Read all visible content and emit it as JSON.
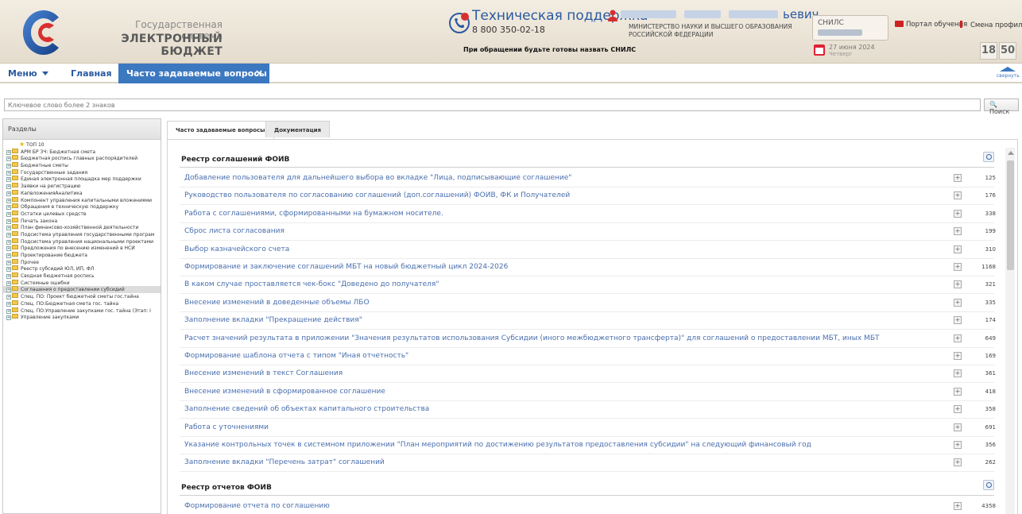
{
  "header": {
    "system_line1": "Государственная система",
    "system_line2": "ЭЛЕКТРОННЫЙ БЮДЖЕТ",
    "support_title": "Техническая поддержка",
    "support_phone": "8 800 350-02-18",
    "support_note": "При обращении будьте готовы назвать СНИЛС",
    "user_name_tail": "ьевич",
    "ministry": "МИНИСТЕРСТВО НАУКИ И ВЫСШЕГО ОБРАЗОВАНИЯ РОССИЙСКОЙ ФЕДЕРАЦИИ",
    "snils_label": "СНИЛС",
    "date": "27 июня 2024",
    "weekday": "Четверг",
    "portal_label": "Портал обучения",
    "change_profile_label": "Смена профиля",
    "clock_hours": "18",
    "clock_minutes": "50",
    "accent": "#3c78c0"
  },
  "nav": {
    "menu_label": "Меню",
    "home_label": "Главная",
    "active_tab_label": "Часто задаваемые вопросы",
    "close_symbol": "×",
    "collapse_label": "свернуть"
  },
  "search": {
    "placeholder": "Ключевое слово более 2 знаков",
    "button_label": "Поиск"
  },
  "left": {
    "header": "Разделы",
    "top_item": "ТОП 10",
    "items": [
      "АРМ БР 3Ч: Бюджетная смета",
      "Бюджетная роспись главных распорядителей",
      "Бюджетные сметы",
      "Государственные задания",
      "Единая электронная площадка мер поддержки",
      "Заявки на регистрацию",
      "КапвложенияАналитика",
      "Компонент управления капитальными вложениями",
      "Обращения в техническую поддержку",
      "Остатки целевых средств",
      "Печать закона",
      "План финансово-хозяйственной деятельности",
      "Подсистема управления государственными програм",
      "Подсистема управления национальными проектами",
      "Предложения по внесению изменений в НСИ",
      "Проектирование бюджета",
      "Прочее",
      "Реестр субсидий ЮЛ, ИП, ФЛ",
      "Сводная бюджетная роспись",
      "Системные ошибки",
      "Соглашения о предоставлении субсидий",
      "Спец. ПО: Проект бюджетной сметы гос.тайна",
      "Спец. ПО:Бюджетная смета гос. тайна",
      "Спец. ПО:Управление закупками гос. тайна (Этап: I",
      "Управление закупками"
    ],
    "selected_index": 20
  },
  "tabs": {
    "faq": "Часто задаваемые вопросы",
    "docs": "Документация"
  },
  "sections": [
    {
      "title": "Реестр соглашений ФОИВ",
      "rows": [
        {
          "text": "Добавление пользователя для дальнейшего выбора во вкладке \"Лица, подписывающие соглашение\"",
          "count": "125"
        },
        {
          "text": "Руководство пользователя по согласованию соглашений (доп.соглашений) ФОИВ, ФК и Получателей",
          "count": "176"
        },
        {
          "text": "Работа с соглашениями, сформированными на бумажном носителе.",
          "count": "338"
        },
        {
          "text": "Сброс листа согласования",
          "count": "199"
        },
        {
          "text": "Выбор казначейского счета",
          "count": "310"
        },
        {
          "text": "Формирование и заключение соглашений МБТ на новый бюджетный цикл 2024-2026",
          "count": "1168"
        },
        {
          "text": "В каком случае проставляется чек-бокс \"Доведено до получателя\"",
          "count": "321"
        },
        {
          "text": "Внесение изменений в доведенные объемы ЛБО",
          "count": "335"
        },
        {
          "text": "Заполнение вкладки \"Прекращение действия\"",
          "count": "174"
        },
        {
          "text": "Расчет значений результата в приложении \"Значения результатов использования Субсидии (иного межбюджетного трансферта)\" для соглашений о предоставлении МБТ, иных МБТ",
          "count": "649"
        },
        {
          "text": "Формирование шаблона отчета с типом \"Иная отчетность\"",
          "count": "169"
        },
        {
          "text": "Внесение изменений в текст Соглашения",
          "count": "361"
        },
        {
          "text": "Внесение изменений в сформированное соглашение",
          "count": "418"
        },
        {
          "text": "Заполнение сведений об объектах капитального строительства",
          "count": "358"
        },
        {
          "text": "Работа с уточнениями",
          "count": "691"
        },
        {
          "text": "Указание контрольных точек в системном приложении \"План мероприятий по достижению результатов предоставления субсидии\" на следующий финансовый год",
          "count": "356"
        },
        {
          "text": "Заполнение вкладки \"Перечень затрат\" соглашений",
          "count": "262"
        }
      ]
    },
    {
      "title": "Реестр отчетов ФОИВ",
      "rows": [
        {
          "text": "Формирование отчета по соглашению",
          "count": "4358"
        }
      ]
    }
  ],
  "expand_symbol": "+"
}
